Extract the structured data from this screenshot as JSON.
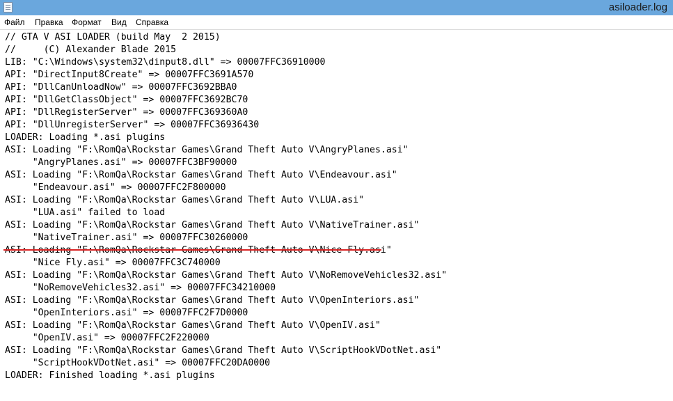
{
  "window": {
    "title": "asiloader.log",
    "icon": "notepad-icon"
  },
  "menubar": {
    "items": [
      "Файл",
      "Правка",
      "Формат",
      "Вид",
      "Справка"
    ]
  },
  "editor": {
    "lines": [
      "// GTA V ASI LOADER (build May  2 2015)",
      "//     (C) Alexander Blade 2015",
      "LIB: \"C:\\Windows\\system32\\dinput8.dll\" => 00007FFC36910000",
      "API: \"DirectInput8Create\" => 00007FFC3691A570",
      "API: \"DllCanUnloadNow\" => 00007FFC3692BBA0",
      "API: \"DllGetClassObject\" => 00007FFC3692BC70",
      "API: \"DllRegisterServer\" => 00007FFC369360A0",
      "API: \"DllUnregisterServer\" => 00007FFC36936430",
      "LOADER: Loading *.asi plugins",
      "ASI: Loading \"F:\\RomQa\\Rockstar Games\\Grand Theft Auto V\\AngryPlanes.asi\"",
      "     \"AngryPlanes.asi\" => 00007FFC3BF90000",
      "ASI: Loading \"F:\\RomQa\\Rockstar Games\\Grand Theft Auto V\\Endeavour.asi\"",
      "     \"Endeavour.asi\" => 00007FFC2F800000",
      "ASI: Loading \"F:\\RomQa\\Rockstar Games\\Grand Theft Auto V\\LUA.asi\"",
      "     \"LUA.asi\" failed to load",
      "ASI: Loading \"F:\\RomQa\\Rockstar Games\\Grand Theft Auto V\\NativeTrainer.asi\"",
      "     \"NativeTrainer.asi\" => 00007FFC30260000",
      "ASI: Loading \"F:\\RomQa\\Rockstar Games\\Grand Theft Auto V\\Nice Fly.asi\"",
      "     \"Nice Fly.asi\" => 00007FFC3C740000",
      "ASI: Loading \"F:\\RomQa\\Rockstar Games\\Grand Theft Auto V\\NoRemoveVehicles32.asi\"",
      "     \"NoRemoveVehicles32.asi\" => 00007FFC34210000",
      "ASI: Loading \"F:\\RomQa\\Rockstar Games\\Grand Theft Auto V\\OpenInteriors.asi\"",
      "     \"OpenInteriors.asi\" => 00007FFC2F7D0000",
      "ASI: Loading \"F:\\RomQa\\Rockstar Games\\Grand Theft Auto V\\OpenIV.asi\"",
      "     \"OpenIV.asi\" => 00007FFC2F220000",
      "ASI: Loading \"F:\\RomQa\\Rockstar Games\\Grand Theft Auto V\\ScriptHookVDotNet.asi\"",
      "     \"ScriptHookVDotNet.asi\" => 00007FFC20DA0000",
      "LOADER: Finished loading *.asi plugins"
    ]
  },
  "colors": {
    "titlebar": "#6aa7dd",
    "underline_annotation": "#d92323"
  }
}
